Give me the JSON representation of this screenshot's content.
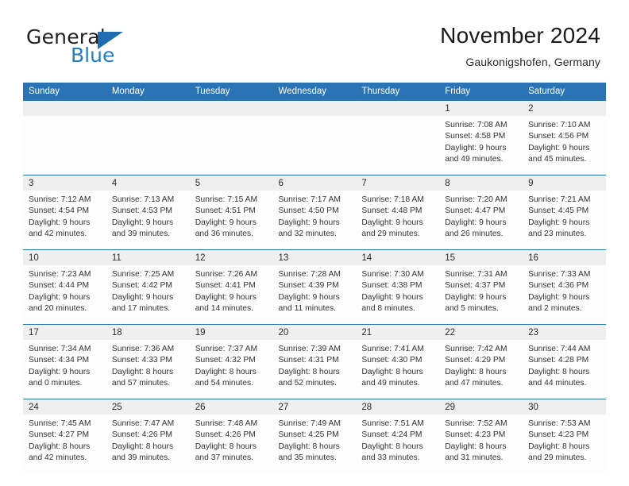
{
  "brand": {
    "word_one": "General",
    "word_two": "Blue",
    "triangle_icon": "triangle-icon",
    "accent_dark": "#1f6cb0",
    "accent_light": "#1f7ec4"
  },
  "header": {
    "title": "November 2024",
    "subtitle": "Gaukonigshofen, Germany"
  },
  "theme": {
    "header_blue": "#2a74b6",
    "day_band_gray": "#efefef",
    "body_white": "#fdfdfd",
    "text": "#333333"
  },
  "calendar": {
    "weekday_headers": [
      "Sunday",
      "Monday",
      "Tuesday",
      "Wednesday",
      "Thursday",
      "Friday",
      "Saturday"
    ],
    "weeks": [
      {
        "days": [
          {
            "number": "",
            "lines": [
              "",
              "",
              "",
              ""
            ],
            "empty": true
          },
          {
            "number": "",
            "lines": [
              "",
              "",
              "",
              ""
            ],
            "empty": true
          },
          {
            "number": "",
            "lines": [
              "",
              "",
              "",
              ""
            ],
            "empty": true
          },
          {
            "number": "",
            "lines": [
              "",
              "",
              "",
              ""
            ],
            "empty": true
          },
          {
            "number": "",
            "lines": [
              "",
              "",
              "",
              ""
            ],
            "empty": true
          },
          {
            "number": "1",
            "lines": [
              "Sunrise: 7:08 AM",
              "Sunset: 4:58 PM",
              "Daylight: 9 hours",
              "and 49 minutes."
            ],
            "sunrise": "7:08 AM",
            "sunset": "4:58 PM",
            "daylight": "9 hours and 49 minutes."
          },
          {
            "number": "2",
            "lines": [
              "Sunrise: 7:10 AM",
              "Sunset: 4:56 PM",
              "Daylight: 9 hours",
              "and 45 minutes."
            ],
            "sunrise": "7:10 AM",
            "sunset": "4:56 PM",
            "daylight": "9 hours and 45 minutes."
          }
        ]
      },
      {
        "days": [
          {
            "number": "3",
            "lines": [
              "Sunrise: 7:12 AM",
              "Sunset: 4:54 PM",
              "Daylight: 9 hours",
              "and 42 minutes."
            ],
            "sunrise": "7:12 AM",
            "sunset": "4:54 PM",
            "daylight": "9 hours and 42 minutes."
          },
          {
            "number": "4",
            "lines": [
              "Sunrise: 7:13 AM",
              "Sunset: 4:53 PM",
              "Daylight: 9 hours",
              "and 39 minutes."
            ],
            "sunrise": "7:13 AM",
            "sunset": "4:53 PM",
            "daylight": "9 hours and 39 minutes."
          },
          {
            "number": "5",
            "lines": [
              "Sunrise: 7:15 AM",
              "Sunset: 4:51 PM",
              "Daylight: 9 hours",
              "and 36 minutes."
            ],
            "sunrise": "7:15 AM",
            "sunset": "4:51 PM",
            "daylight": "9 hours and 36 minutes."
          },
          {
            "number": "6",
            "lines": [
              "Sunrise: 7:17 AM",
              "Sunset: 4:50 PM",
              "Daylight: 9 hours",
              "and 32 minutes."
            ],
            "sunrise": "7:17 AM",
            "sunset": "4:50 PM",
            "daylight": "9 hours and 32 minutes."
          },
          {
            "number": "7",
            "lines": [
              "Sunrise: 7:18 AM",
              "Sunset: 4:48 PM",
              "Daylight: 9 hours",
              "and 29 minutes."
            ],
            "sunrise": "7:18 AM",
            "sunset": "4:48 PM",
            "daylight": "9 hours and 29 minutes."
          },
          {
            "number": "8",
            "lines": [
              "Sunrise: 7:20 AM",
              "Sunset: 4:47 PM",
              "Daylight: 9 hours",
              "and 26 minutes."
            ],
            "sunrise": "7:20 AM",
            "sunset": "4:47 PM",
            "daylight": "9 hours and 26 minutes."
          },
          {
            "number": "9",
            "lines": [
              "Sunrise: 7:21 AM",
              "Sunset: 4:45 PM",
              "Daylight: 9 hours",
              "and 23 minutes."
            ],
            "sunrise": "7:21 AM",
            "sunset": "4:45 PM",
            "daylight": "9 hours and 23 minutes."
          }
        ]
      },
      {
        "days": [
          {
            "number": "10",
            "lines": [
              "Sunrise: 7:23 AM",
              "Sunset: 4:44 PM",
              "Daylight: 9 hours",
              "and 20 minutes."
            ],
            "sunrise": "7:23 AM",
            "sunset": "4:44 PM",
            "daylight": "9 hours and 20 minutes."
          },
          {
            "number": "11",
            "lines": [
              "Sunrise: 7:25 AM",
              "Sunset: 4:42 PM",
              "Daylight: 9 hours",
              "and 17 minutes."
            ],
            "sunrise": "7:25 AM",
            "sunset": "4:42 PM",
            "daylight": "9 hours and 17 minutes."
          },
          {
            "number": "12",
            "lines": [
              "Sunrise: 7:26 AM",
              "Sunset: 4:41 PM",
              "Daylight: 9 hours",
              "and 14 minutes."
            ],
            "sunrise": "7:26 AM",
            "sunset": "4:41 PM",
            "daylight": "9 hours and 14 minutes."
          },
          {
            "number": "13",
            "lines": [
              "Sunrise: 7:28 AM",
              "Sunset: 4:39 PM",
              "Daylight: 9 hours",
              "and 11 minutes."
            ],
            "sunrise": "7:28 AM",
            "sunset": "4:39 PM",
            "daylight": "9 hours and 11 minutes."
          },
          {
            "number": "14",
            "lines": [
              "Sunrise: 7:30 AM",
              "Sunset: 4:38 PM",
              "Daylight: 9 hours",
              "and 8 minutes."
            ],
            "sunrise": "7:30 AM",
            "sunset": "4:38 PM",
            "daylight": "9 hours and 8 minutes."
          },
          {
            "number": "15",
            "lines": [
              "Sunrise: 7:31 AM",
              "Sunset: 4:37 PM",
              "Daylight: 9 hours",
              "and 5 minutes."
            ],
            "sunrise": "7:31 AM",
            "sunset": "4:37 PM",
            "daylight": "9 hours and 5 minutes."
          },
          {
            "number": "16",
            "lines": [
              "Sunrise: 7:33 AM",
              "Sunset: 4:36 PM",
              "Daylight: 9 hours",
              "and 2 minutes."
            ],
            "sunrise": "7:33 AM",
            "sunset": "4:36 PM",
            "daylight": "9 hours and 2 minutes."
          }
        ]
      },
      {
        "days": [
          {
            "number": "17",
            "lines": [
              "Sunrise: 7:34 AM",
              "Sunset: 4:34 PM",
              "Daylight: 9 hours",
              "and 0 minutes."
            ],
            "sunrise": "7:34 AM",
            "sunset": "4:34 PM",
            "daylight": "9 hours and 0 minutes."
          },
          {
            "number": "18",
            "lines": [
              "Sunrise: 7:36 AM",
              "Sunset: 4:33 PM",
              "Daylight: 8 hours",
              "and 57 minutes."
            ],
            "sunrise": "7:36 AM",
            "sunset": "4:33 PM",
            "daylight": "8 hours and 57 minutes."
          },
          {
            "number": "19",
            "lines": [
              "Sunrise: 7:37 AM",
              "Sunset: 4:32 PM",
              "Daylight: 8 hours",
              "and 54 minutes."
            ],
            "sunrise": "7:37 AM",
            "sunset": "4:32 PM",
            "daylight": "8 hours and 54 minutes."
          },
          {
            "number": "20",
            "lines": [
              "Sunrise: 7:39 AM",
              "Sunset: 4:31 PM",
              "Daylight: 8 hours",
              "and 52 minutes."
            ],
            "sunrise": "7:39 AM",
            "sunset": "4:31 PM",
            "daylight": "8 hours and 52 minutes."
          },
          {
            "number": "21",
            "lines": [
              "Sunrise: 7:41 AM",
              "Sunset: 4:30 PM",
              "Daylight: 8 hours",
              "and 49 minutes."
            ],
            "sunrise": "7:41 AM",
            "sunset": "4:30 PM",
            "daylight": "8 hours and 49 minutes."
          },
          {
            "number": "22",
            "lines": [
              "Sunrise: 7:42 AM",
              "Sunset: 4:29 PM",
              "Daylight: 8 hours",
              "and 47 minutes."
            ],
            "sunrise": "7:42 AM",
            "sunset": "4:29 PM",
            "daylight": "8 hours and 47 minutes."
          },
          {
            "number": "23",
            "lines": [
              "Sunrise: 7:44 AM",
              "Sunset: 4:28 PM",
              "Daylight: 8 hours",
              "and 44 minutes."
            ],
            "sunrise": "7:44 AM",
            "sunset": "4:28 PM",
            "daylight": "8 hours and 44 minutes."
          }
        ]
      },
      {
        "days": [
          {
            "number": "24",
            "lines": [
              "Sunrise: 7:45 AM",
              "Sunset: 4:27 PM",
              "Daylight: 8 hours",
              "and 42 minutes."
            ],
            "sunrise": "7:45 AM",
            "sunset": "4:27 PM",
            "daylight": "8 hours and 42 minutes."
          },
          {
            "number": "25",
            "lines": [
              "Sunrise: 7:47 AM",
              "Sunset: 4:26 PM",
              "Daylight: 8 hours",
              "and 39 minutes."
            ],
            "sunrise": "7:47 AM",
            "sunset": "4:26 PM",
            "daylight": "8 hours and 39 minutes."
          },
          {
            "number": "26",
            "lines": [
              "Sunrise: 7:48 AM",
              "Sunset: 4:26 PM",
              "Daylight: 8 hours",
              "and 37 minutes."
            ],
            "sunrise": "7:48 AM",
            "sunset": "4:26 PM",
            "daylight": "8 hours and 37 minutes."
          },
          {
            "number": "27",
            "lines": [
              "Sunrise: 7:49 AM",
              "Sunset: 4:25 PM",
              "Daylight: 8 hours",
              "and 35 minutes."
            ],
            "sunrise": "7:49 AM",
            "sunset": "4:25 PM",
            "daylight": "8 hours and 35 minutes."
          },
          {
            "number": "28",
            "lines": [
              "Sunrise: 7:51 AM",
              "Sunset: 4:24 PM",
              "Daylight: 8 hours",
              "and 33 minutes."
            ],
            "sunrise": "7:51 AM",
            "sunset": "4:24 PM",
            "daylight": "8 hours and 33 minutes."
          },
          {
            "number": "29",
            "lines": [
              "Sunrise: 7:52 AM",
              "Sunset: 4:23 PM",
              "Daylight: 8 hours",
              "and 31 minutes."
            ],
            "sunrise": "7:52 AM",
            "sunset": "4:23 PM",
            "daylight": "8 hours and 31 minutes."
          },
          {
            "number": "30",
            "lines": [
              "Sunrise: 7:53 AM",
              "Sunset: 4:23 PM",
              "Daylight: 8 hours",
              "and 29 minutes."
            ],
            "sunrise": "7:53 AM",
            "sunset": "4:23 PM",
            "daylight": "8 hours and 29 minutes."
          }
        ]
      }
    ]
  }
}
